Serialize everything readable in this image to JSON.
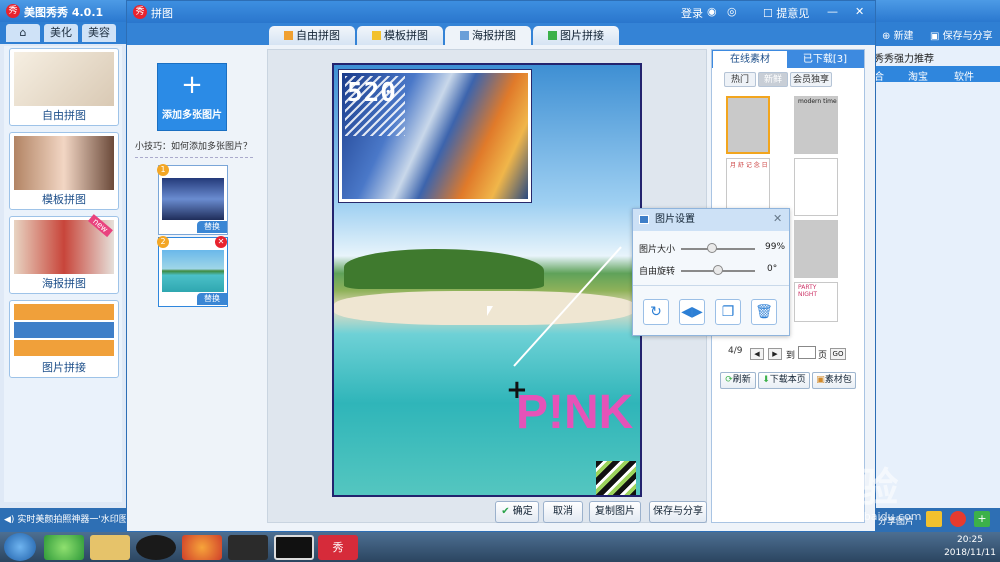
{
  "app": {
    "title": "美图秀秀 4.0.1",
    "left_tabs": [
      "美化",
      "美容"
    ]
  },
  "left_cards": [
    {
      "label": "自由拼图"
    },
    {
      "label": "模板拼图"
    },
    {
      "label": "海报拼图",
      "badge": "new"
    },
    {
      "label": "图片拼接"
    }
  ],
  "left_bottom_text": "实时美颜拍照神器一'水印图",
  "dialog": {
    "title": "拼图",
    "login": "登录",
    "feedback": "提意见",
    "tabs": [
      "自由拼图",
      "模板拼图",
      "海报拼图",
      "图片拼接"
    ],
    "active_tab": "海报拼图",
    "add_button": "添加多张图片",
    "tip": "小技巧：如何添加多张图片？",
    "thumbs": [
      {
        "num": "1",
        "replace": "替换"
      },
      {
        "num": "2",
        "replace": "替换"
      }
    ],
    "poster_text_520": "520",
    "poster_text_pink": "P!NK",
    "buttons": {
      "confirm": "确定",
      "cancel": "取消",
      "copy": "复制图片",
      "save": "保存与分享"
    }
  },
  "popup": {
    "title": "图片设置",
    "size_label": "图片大小",
    "size_value": "99%",
    "size_fraction": 0.99,
    "rotate_label": "自由旋转",
    "rotate_value": "0°",
    "buttons": [
      "rotate-icon",
      "flip-icon",
      "copy-icon",
      "delete-icon"
    ]
  },
  "materials": {
    "tab_online": "在线素材",
    "tab_downloaded": "已下载[3]",
    "filters": [
      "热门",
      "新鲜",
      "会员独享"
    ],
    "active_filter": "新鲜",
    "thumb_texts": [
      "",
      "modern time",
      "月 舒 记 念 日",
      "",
      "",
      "PARTY NIGHT"
    ],
    "page": "4/9",
    "goto": "到",
    "page_word": "页",
    "go": "GO",
    "refresh": "刷新",
    "download_page": "下载本页",
    "pack": "素材包"
  },
  "right_back": {
    "new": "新建",
    "save_share": "保存与分享",
    "recommend": "秀秀强力推荐",
    "nav": [
      "合",
      "淘宝",
      "软件"
    ],
    "share": "分享图片"
  },
  "taskbar": {
    "time": "20:25",
    "date": "2018/11/11"
  },
  "watermark": {
    "text": "Bai 经验",
    "url": "jingyan.baidu.com"
  }
}
